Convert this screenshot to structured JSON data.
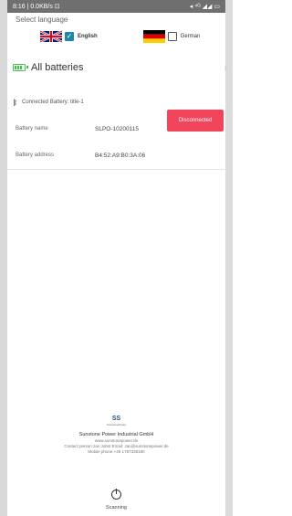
{
  "status_bar": {
    "left": "8:16 | 0.0KB/s ⊡",
    "right": "◂ ⁴ᴳ ◢◢ ▭"
  },
  "language": {
    "label": "Select language",
    "english": {
      "name": "English",
      "checked": true
    },
    "german": {
      "name": "German",
      "checked": false
    }
  },
  "batteries": {
    "label": "All batteries"
  },
  "connection": {
    "status_text": "Connected Battery: title-1",
    "disconnect_label": "Disconnected",
    "disconnect_color": "#f0455a"
  },
  "battery_info": {
    "name_label": "Battery name",
    "name_value": "SLPO-10200115",
    "address_label": "Battery address",
    "address_value": "B4:52:A9:B0:3A:06"
  },
  "footer": {
    "logo_text": "SS",
    "logo_sub": "SunstonePower",
    "company": "Sunstone Power Industrial GmbH",
    "website": "www.sunstonepower.de",
    "contact": "Contact person:Jan Jobst Email: Jan@sunstonepower.de",
    "mobile": "Mobile phone:+49 1787338180"
  },
  "scan": {
    "label": "Scanning"
  }
}
